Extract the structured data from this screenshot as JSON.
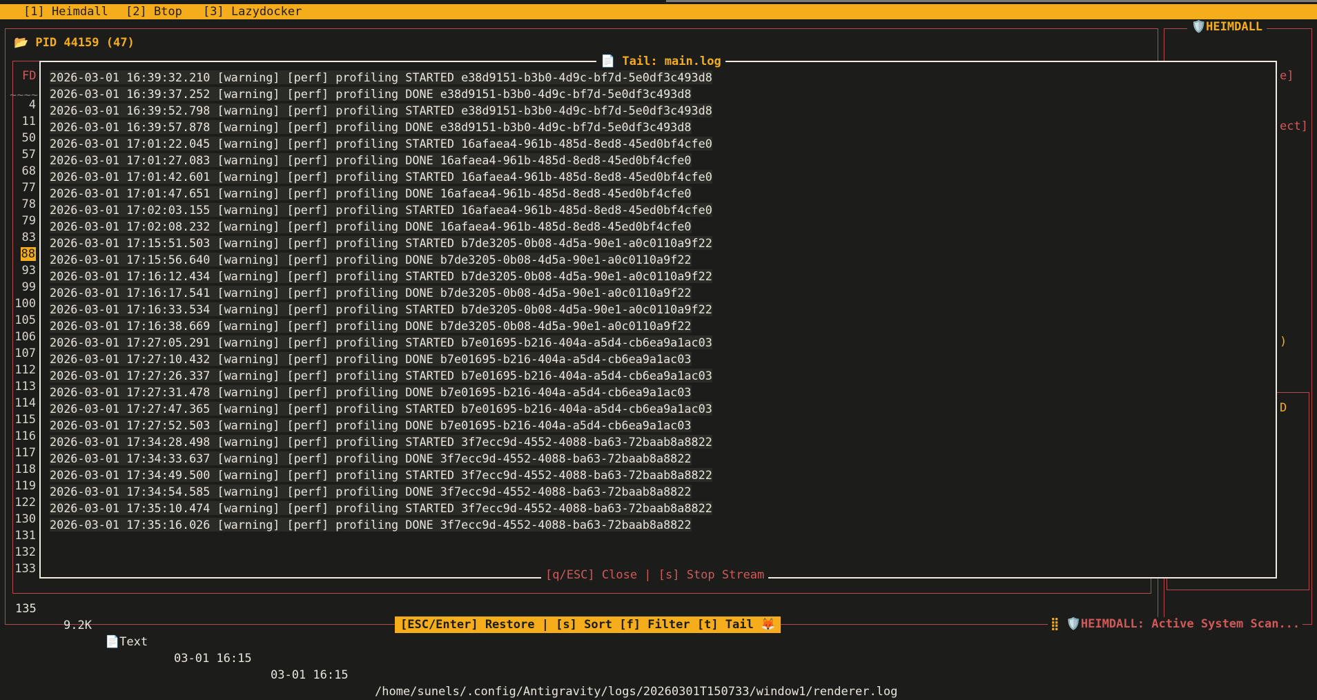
{
  "tabs": [
    "[1] Heimdall",
    "[2] Btop",
    "[3] Lazydocker"
  ],
  "side_panel_title": "🛡️HEIMDALL",
  "pid_panel_title": "📂 PID 44159 (47)",
  "fd_header": "FD",
  "tilde_row": "~~~~",
  "fd_numbers": [
    "4",
    "11",
    "50",
    "57",
    "68",
    "77",
    "78",
    "79",
    "83",
    "88",
    "93",
    "99",
    "100",
    "105",
    "106",
    "107",
    "112",
    "113",
    "114",
    "115",
    "116",
    "117",
    "118",
    "119",
    "122",
    "130",
    "131",
    "132",
    "133"
  ],
  "selected_fd": "88",
  "right_fragments": [
    "e]",
    "ect]",
    ")",
    "D"
  ],
  "modal": {
    "title": "📄 Tail: main.log",
    "footer": "[q/ESC] Close | [s] Stop Stream",
    "lines": [
      "2026-03-01 16:39:32.210 [warning] [perf] profiling STARTED e38d9151-b3b0-4d9c-bf7d-5e0df3c493d8",
      "2026-03-01 16:39:37.252 [warning] [perf] profiling DONE e38d9151-b3b0-4d9c-bf7d-5e0df3c493d8",
      "2026-03-01 16:39:52.798 [warning] [perf] profiling STARTED e38d9151-b3b0-4d9c-bf7d-5e0df3c493d8",
      "2026-03-01 16:39:57.878 [warning] [perf] profiling DONE e38d9151-b3b0-4d9c-bf7d-5e0df3c493d8",
      "2026-03-01 17:01:22.045 [warning] [perf] profiling STARTED 16afaea4-961b-485d-8ed8-45ed0bf4cfe0",
      "2026-03-01 17:01:27.083 [warning] [perf] profiling DONE 16afaea4-961b-485d-8ed8-45ed0bf4cfe0",
      "2026-03-01 17:01:42.601 [warning] [perf] profiling STARTED 16afaea4-961b-485d-8ed8-45ed0bf4cfe0",
      "2026-03-01 17:01:47.651 [warning] [perf] profiling DONE 16afaea4-961b-485d-8ed8-45ed0bf4cfe0",
      "2026-03-01 17:02:03.155 [warning] [perf] profiling STARTED 16afaea4-961b-485d-8ed8-45ed0bf4cfe0",
      "2026-03-01 17:02:08.232 [warning] [perf] profiling DONE 16afaea4-961b-485d-8ed8-45ed0bf4cfe0",
      "2026-03-01 17:15:51.503 [warning] [perf] profiling STARTED b7de3205-0b08-4d5a-90e1-a0c0110a9f22",
      "2026-03-01 17:15:56.640 [warning] [perf] profiling DONE b7de3205-0b08-4d5a-90e1-a0c0110a9f22",
      "2026-03-01 17:16:12.434 [warning] [perf] profiling STARTED b7de3205-0b08-4d5a-90e1-a0c0110a9f22",
      "2026-03-01 17:16:17.541 [warning] [perf] profiling DONE b7de3205-0b08-4d5a-90e1-a0c0110a9f22",
      "2026-03-01 17:16:33.534 [warning] [perf] profiling STARTED b7de3205-0b08-4d5a-90e1-a0c0110a9f22",
      "2026-03-01 17:16:38.669 [warning] [perf] profiling DONE b7de3205-0b08-4d5a-90e1-a0c0110a9f22",
      "2026-03-01 17:27:05.291 [warning] [perf] profiling STARTED b7e01695-b216-404a-a5d4-cb6ea9a1ac03",
      "2026-03-01 17:27:10.432 [warning] [perf] profiling DONE b7e01695-b216-404a-a5d4-cb6ea9a1ac03",
      "2026-03-01 17:27:26.337 [warning] [perf] profiling STARTED b7e01695-b216-404a-a5d4-cb6ea9a1ac03",
      "2026-03-01 17:27:31.478 [warning] [perf] profiling DONE b7e01695-b216-404a-a5d4-cb6ea9a1ac03",
      "2026-03-01 17:27:47.365 [warning] [perf] profiling STARTED b7e01695-b216-404a-a5d4-cb6ea9a1ac03",
      "2026-03-01 17:27:52.503 [warning] [perf] profiling DONE b7e01695-b216-404a-a5d4-cb6ea9a1ac03",
      "2026-03-01 17:34:28.498 [warning] [perf] profiling STARTED 3f7ecc9d-4552-4088-ba63-72baab8a8822",
      "2026-03-01 17:34:33.637 [warning] [perf] profiling DONE 3f7ecc9d-4552-4088-ba63-72baab8a8822",
      "2026-03-01 17:34:49.500 [warning] [perf] profiling STARTED 3f7ecc9d-4552-4088-ba63-72baab8a8822",
      "2026-03-01 17:34:54.585 [warning] [perf] profiling DONE 3f7ecc9d-4552-4088-ba63-72baab8a8822",
      "2026-03-01 17:35:10.474 [warning] [perf] profiling STARTED 3f7ecc9d-4552-4088-ba63-72baab8a8822",
      "2026-03-01 17:35:16.026 [warning] [perf] profiling DONE 3f7ecc9d-4552-4088-ba63-72baab8a8822"
    ]
  },
  "row_135": {
    "fd": "135",
    "size": "9.2K",
    "type": "📄Text",
    "created": "03-01 16:15",
    "modified": "03-01 16:15",
    "path": "/home/sunels/.config/Antigravity/logs/20260301T150733/window1/renderer.log"
  },
  "bottom_hint": "[ESC/Enter] Restore | [s] Sort [f] Filter [t] Tail 🦊",
  "status_grip": "⣿",
  "status_text": "🛡️HEIMDALL: Active System Scan...",
  "colors": {
    "accent": "#f6ad1c",
    "border": "#b54a4a",
    "alert_text": "#d05a5a",
    "background": "#1c1c1a"
  }
}
